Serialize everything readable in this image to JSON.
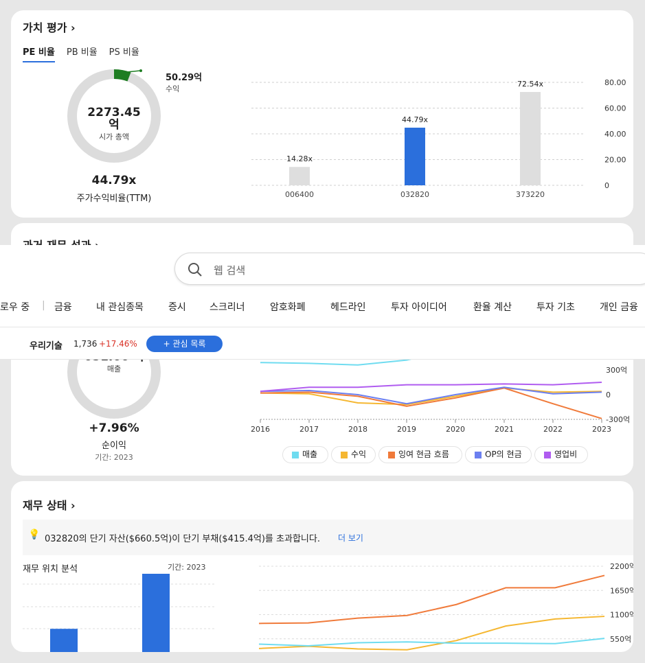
{
  "valuation": {
    "title": "가치 평가",
    "tabs": [
      "PE 비율",
      "PB 비율",
      "PS 비율"
    ],
    "market_cap": "2273.45",
    "market_cap_unit": "억",
    "market_cap_label": "시가 총액",
    "earnings_value": "50.29억",
    "earnings_label": "수익",
    "pe_value": "44.79x",
    "pe_label": "주가수익비율(TTM)"
  },
  "past_performance": {
    "title": "과거 재무 성과",
    "revenue_value": "651.66 억",
    "revenue_label": "매출",
    "net_income_change": "+7.96%",
    "net_income_label": "순이익",
    "period": "기간: 2023",
    "legend": [
      "매출",
      "수익",
      "잉여 현금 흐름",
      "OP의 현금",
      "영업비"
    ]
  },
  "financial_health": {
    "title": "재무 상태",
    "info_text": "032820의 단기 자산($660.5억)이 단기 부채($415.4억)를 초과합니다.",
    "more_link": "더 보기",
    "analysis_title": "재무 위치 분석",
    "period": "기간: 2023"
  },
  "search": {
    "placeholder": "웹 검색"
  },
  "nav": {
    "items": [
      "로우 중",
      "금융",
      "내 관심종목",
      "증시",
      "스크리너",
      "암호화폐",
      "헤드라인",
      "투자 아이디어",
      "환율 계산",
      "투자 기초",
      "개인 금융"
    ]
  },
  "ticker": {
    "name": "우리기술",
    "price": "1,736",
    "change": "+17.46%",
    "watch_button": "+ 관심 목록"
  },
  "colors": {
    "accent": "#2b6fdc",
    "up": "#d93025",
    "revenue": "#6fdcf0",
    "earnings": "#f5b731",
    "fcf": "#f07a3a",
    "opcash": "#6b7ff0",
    "opex": "#b05cf0"
  },
  "chart_data": [
    {
      "type": "bar",
      "categories": [
        "006400",
        "032820",
        "373220"
      ],
      "values": [
        14.28,
        44.79,
        72.54
      ],
      "data_labels": [
        "14.28x",
        "44.79x",
        "72.54x"
      ],
      "yticks": [
        "80.00",
        "60.00",
        "40.00",
        "20.00",
        "0"
      ],
      "ylim": [
        0,
        80
      ],
      "highlight": "032820"
    },
    {
      "type": "line",
      "x": [
        "2016",
        "2017",
        "2018",
        "2019",
        "2020",
        "2021",
        "2022",
        "2023"
      ],
      "yticks": [
        "300억",
        "0",
        "-300억"
      ],
      "ylim": [
        -300,
        300
      ],
      "series": [
        {
          "name": "매출",
          "values": [
            390,
            380,
            360,
            420,
            560,
            null,
            null,
            null
          ]
        },
        {
          "name": "수익",
          "values": [
            20,
            10,
            -100,
            -120,
            -20,
            80,
            30,
            40
          ]
        },
        {
          "name": "잉여 현금 흐름",
          "values": [
            20,
            30,
            -20,
            -140,
            -40,
            80,
            -110,
            -290
          ]
        },
        {
          "name": "OP의 현금",
          "values": [
            40,
            50,
            0,
            -110,
            0,
            90,
            10,
            30
          ]
        },
        {
          "name": "영업비",
          "values": [
            40,
            90,
            90,
            120,
            120,
            130,
            120,
            150
          ]
        }
      ]
    },
    {
      "type": "bar",
      "series": [
        {
          "name": "blue",
          "values": [
            600,
            1900
          ]
        },
        {
          "name": "purple",
          "values": [
            90,
            160
          ]
        }
      ]
    },
    {
      "type": "line",
      "x": [
        "2016",
        "2017",
        "2018",
        "2019",
        "2020",
        "2021",
        "2022",
        "2023"
      ],
      "yticks": [
        "2200억",
        "1650억",
        "1100억",
        "550억",
        "0"
      ],
      "ylim": [
        0,
        2200
      ],
      "series": [
        {
          "name": "orange",
          "values": [
            900,
            910,
            1020,
            1080,
            1330,
            1710,
            1710,
            1990
          ]
        },
        {
          "name": "yellow",
          "values": [
            330,
            380,
            320,
            300,
            510,
            840,
            1000,
            1060
          ]
        },
        {
          "name": "cyan",
          "values": [
            430,
            390,
            460,
            480,
            450,
            450,
            440,
            560
          ]
        }
      ]
    }
  ]
}
